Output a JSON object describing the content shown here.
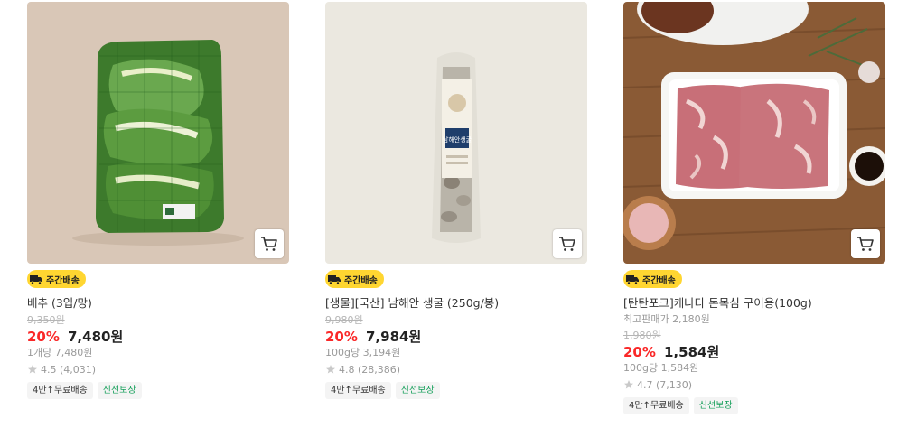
{
  "cart_icon": "cart-icon",
  "badge_icon": "truck-icon",
  "rating_icon": "star-icon",
  "colors": {
    "discount": "#fa2828",
    "badge_bg": "#ffd631",
    "fresh_tag": "#18a05c"
  },
  "products": [
    {
      "badge": "주간배송",
      "title": "배추 (3입/망)",
      "original_price": "9,350원",
      "discount": "20%",
      "price": "7,480원",
      "unit_price": "1개당 7,480원",
      "rating": "4.5 (4,031)",
      "tags": [
        "4만↑무료배송",
        "신선보장"
      ]
    },
    {
      "badge": "주간배송",
      "title": "[생물][국산] 남해안 생굴 (250g/봉)",
      "original_price": "9,980원",
      "discount": "20%",
      "price": "7,984원",
      "unit_price": "100g당 3,194원",
      "rating": "4.8 (28,386)",
      "tags": [
        "4만↑무료배송",
        "신선보장"
      ],
      "package_text": "남해안생굴"
    },
    {
      "badge": "주간배송",
      "title": "[탄탄포크]캐나다 돈목심 구이용(100g)",
      "extra": "최고판매가 2,180원",
      "original_price": "1,980원",
      "discount": "20%",
      "price": "1,584원",
      "unit_price": "100g당 1,584원",
      "rating": "4.7 (7,130)",
      "tags": [
        "4만↑무료배송",
        "신선보장"
      ]
    }
  ]
}
